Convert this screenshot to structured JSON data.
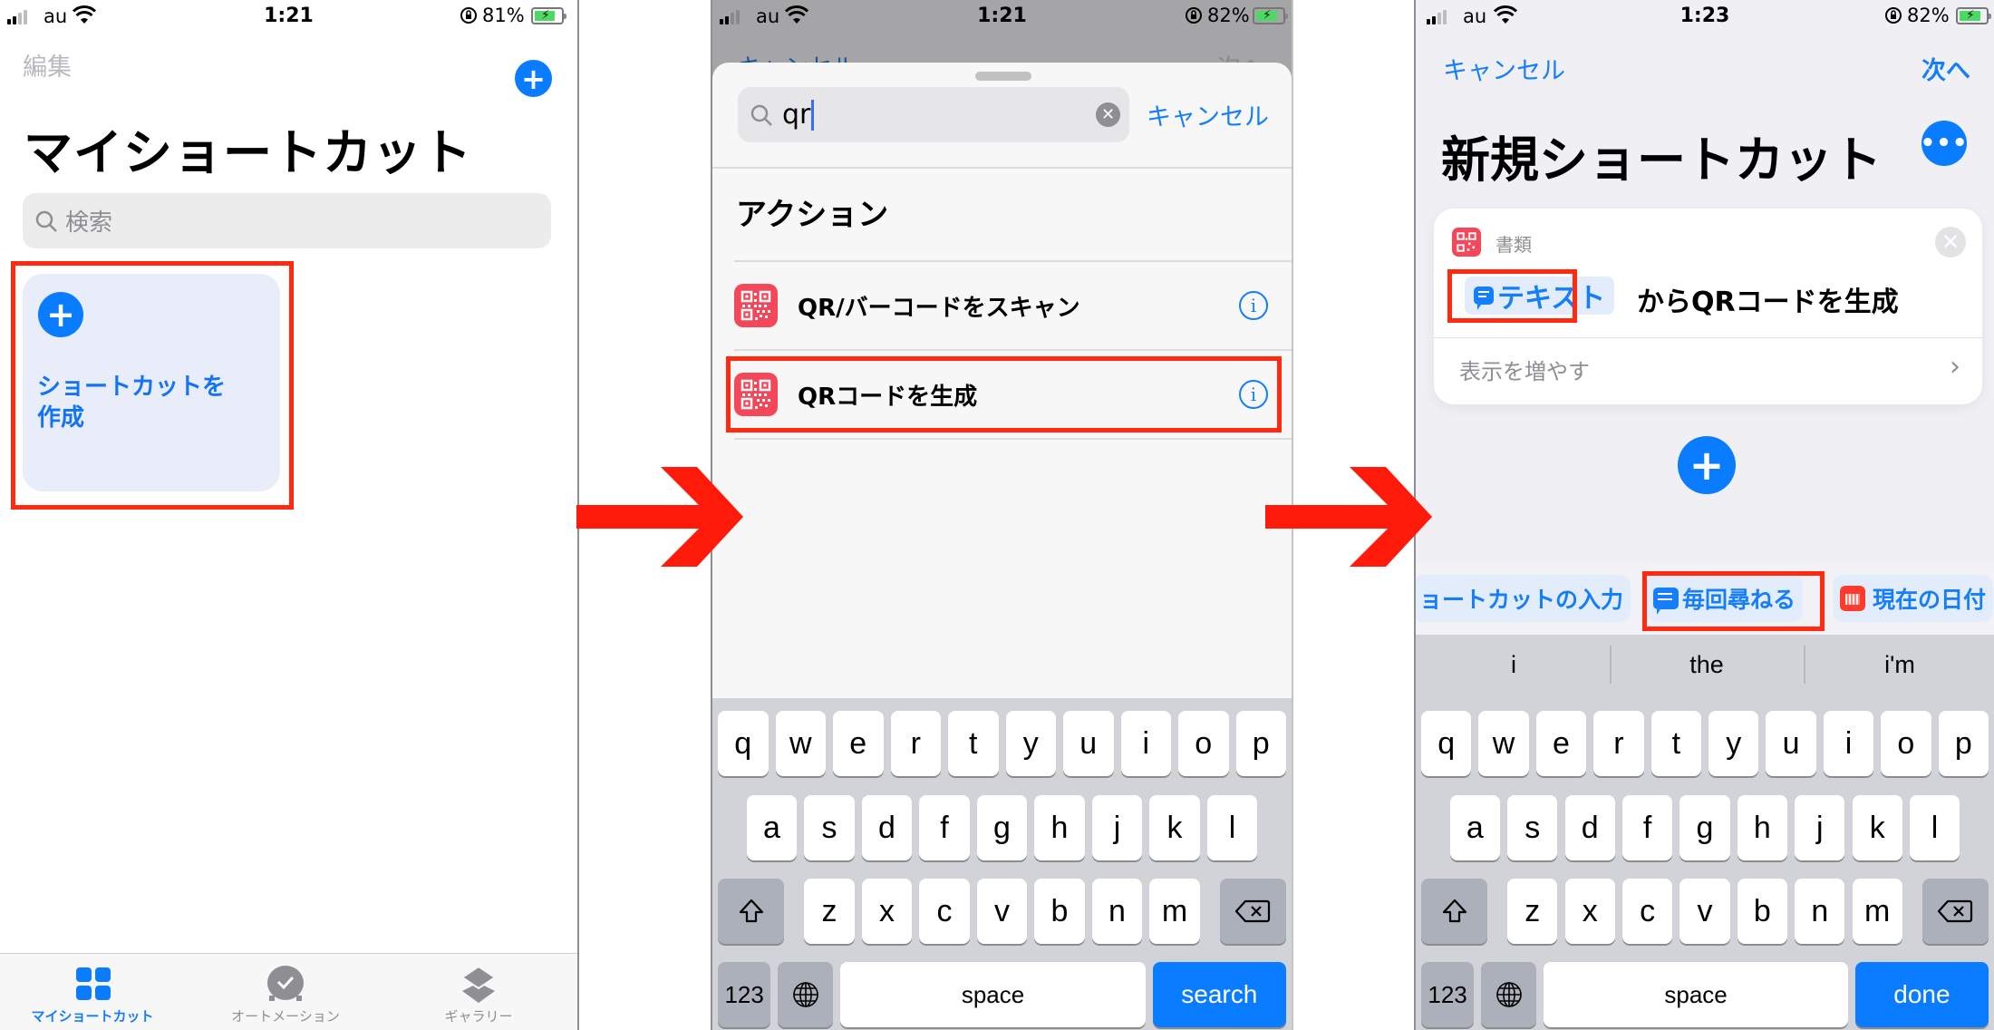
{
  "colors": {
    "accent": "#147efb",
    "highlight_red": "#ff2a10",
    "qr_icon": "#f4485a",
    "arrow": "#ff1a0a"
  },
  "screens": [
    {
      "status": {
        "carrier": "au",
        "time": "1:21",
        "battery": "81%"
      },
      "nav": {
        "edit_label": "編集",
        "add_icon": "plus-circle-icon"
      },
      "title": "マイショートカット",
      "search": {
        "placeholder": "検索"
      },
      "create_card": {
        "label_line1": "ショートカットを",
        "label_line2": "作成"
      },
      "tabs": [
        {
          "label": "マイショートカット",
          "icon": "grid-icon",
          "active": true
        },
        {
          "label": "オートメーション",
          "icon": "automation-clock-icon",
          "active": false
        },
        {
          "label": "ギャラリー",
          "icon": "gallery-layers-icon",
          "active": false
        }
      ]
    },
    {
      "status": {
        "carrier": "au",
        "time": "1:21",
        "battery": "82%"
      },
      "behind": {
        "cancel": "キャンセル",
        "next": "次へ"
      },
      "search": {
        "query": "qr",
        "cancel_label": "キャンセル"
      },
      "section_title": "アクション",
      "actions": [
        {
          "label": "QR/バーコードをスキャン",
          "icon": "qr-code-icon"
        },
        {
          "label": "QRコードを生成",
          "icon": "qr-code-icon",
          "highlighted": true
        }
      ],
      "keyboard": {
        "row1": [
          "q",
          "w",
          "e",
          "r",
          "t",
          "y",
          "u",
          "i",
          "o",
          "p"
        ],
        "row2": [
          "a",
          "s",
          "d",
          "f",
          "g",
          "h",
          "j",
          "k",
          "l"
        ],
        "row3": [
          "z",
          "x",
          "c",
          "v",
          "b",
          "n",
          "m"
        ],
        "numbers": "123",
        "space": "space",
        "action": "search"
      }
    },
    {
      "status": {
        "carrier": "au",
        "time": "1:23",
        "battery": "82%"
      },
      "nav": {
        "cancel": "キャンセル",
        "next": "次へ"
      },
      "title": "新規ショートカット",
      "card": {
        "category": "書類",
        "param_token": "テキスト",
        "action_text": "からQRコードを生成",
        "show_more": "表示を増やす"
      },
      "suggestions": [
        {
          "label": "ョートカットの入力"
        },
        {
          "label": "毎回尋ねる",
          "highlighted": true
        },
        {
          "label": "現在の日付"
        }
      ],
      "predictions": [
        "i",
        "the",
        "i'm"
      ],
      "keyboard": {
        "row1": [
          "q",
          "w",
          "e",
          "r",
          "t",
          "y",
          "u",
          "i",
          "o",
          "p"
        ],
        "row2": [
          "a",
          "s",
          "d",
          "f",
          "g",
          "h",
          "j",
          "k",
          "l"
        ],
        "row3": [
          "z",
          "x",
          "c",
          "v",
          "b",
          "n",
          "m"
        ],
        "numbers": "123",
        "space": "space",
        "action": "done"
      }
    }
  ]
}
